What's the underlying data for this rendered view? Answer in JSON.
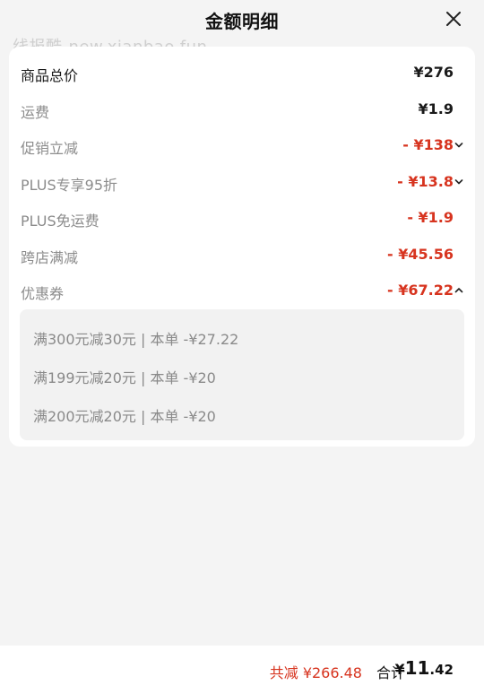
{
  "header": {
    "title": "金额明细",
    "close_icon": "close-icon",
    "watermark": "线报酷-new.xianbao.fun"
  },
  "details": {
    "items": [
      {
        "label": "商品总价",
        "value": "¥276"
      },
      {
        "label": "运费",
        "value": "¥1.9"
      },
      {
        "label": "促销立减",
        "value": "- ¥138",
        "icon": "chevron-down-icon"
      },
      {
        "label": "PLUS专享95折",
        "value": "- ¥13.8",
        "icon": "chevron-down-icon"
      },
      {
        "label": "PLUS免运费",
        "value": "- ¥1.9"
      },
      {
        "label": "跨店满减",
        "value": "- ¥45.56"
      },
      {
        "label": "优惠券",
        "value": "- ¥67.22",
        "icon": "chevron-up-icon"
      }
    ],
    "coupons": [
      "满300元减30元 | 本单 -¥27.22",
      "满199元减20元 | 本单 -¥20",
      "满200元减20元 | 本单 -¥20"
    ]
  },
  "footer": {
    "saved_text": "共减 ¥266.48",
    "total_label": "合计",
    "total_currency": "¥",
    "total_integer": "11",
    "total_decimal": ".42"
  },
  "colors": {
    "accent_red": "#d7341f",
    "background": "#f4f4f4",
    "card": "#ffffff",
    "coupon_box": "#f2f2f2"
  }
}
